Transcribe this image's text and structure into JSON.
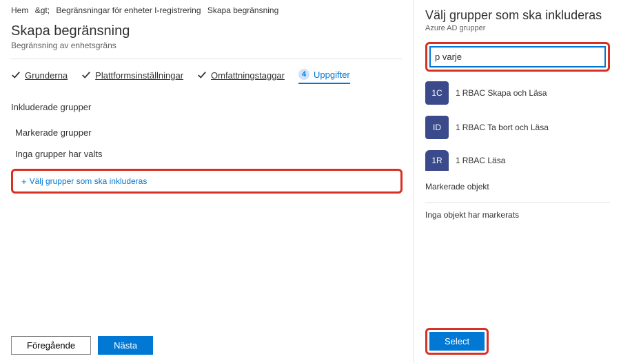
{
  "breadcrumb": {
    "home": "Hem",
    "sep1": "&gt;",
    "level1": "Begränsningar för enheter I-registrering",
    "level2": "Skapa begränsning"
  },
  "page": {
    "title": "Skapa begränsning",
    "subtitle": "Begränsning av enhetsgräns"
  },
  "steps": {
    "s1": "Grunderna",
    "s2": "Plattformsinställningar",
    "s3": "Omfattningstaggar",
    "badge": "4",
    "s4": "Uppgifter"
  },
  "included": {
    "title": "Inkluderade grupper",
    "marked": "Markerade grupper",
    "empty": "Inga grupper har valts",
    "add": "Välj grupper som ska inkluderas"
  },
  "footer": {
    "prev": "Föregående",
    "next": "Nästa"
  },
  "panel": {
    "title": "Välj grupper som ska inkluderas",
    "subtitle": "Azure AD grupper",
    "search_value": "p varje",
    "groups": [
      {
        "avatar": "1C",
        "lead": "1",
        "name": "RBAC Skapa och   Läsa"
      },
      {
        "avatar": "ID",
        "lead": "1",
        "name": "RBAC  Ta bort och   Läsa"
      },
      {
        "avatar": "1R",
        "lead": "1",
        "name": "RBAC  Läsa"
      }
    ],
    "selected_label": "Markerade objekt",
    "selected_empty": "Inga objekt har markerats",
    "select_btn": "Select"
  }
}
